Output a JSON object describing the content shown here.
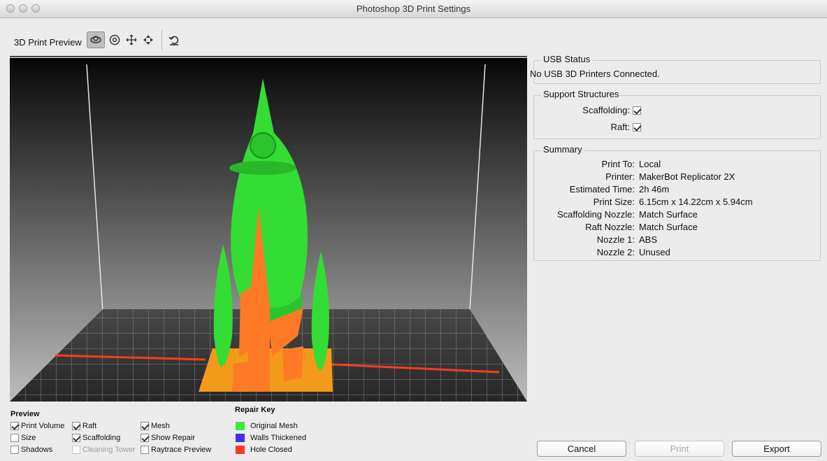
{
  "window": {
    "title": "Photoshop 3D Print Settings"
  },
  "toolbar": {
    "label": "3D Print Preview",
    "tools": [
      {
        "icon": "orbit-icon",
        "active": true
      },
      {
        "icon": "roll-icon",
        "active": false
      },
      {
        "icon": "pan-icon",
        "active": false
      },
      {
        "icon": "slide-icon",
        "active": false
      },
      {
        "icon": "reset-view-icon",
        "active": false
      }
    ]
  },
  "usb": {
    "title": "USB Status",
    "status": "No USB 3D Printers Connected."
  },
  "support": {
    "title": "Support Structures",
    "scaffolding_label": "Scaffolding:",
    "scaffolding_checked": true,
    "raft_label": "Raft:",
    "raft_checked": true
  },
  "summary": {
    "title": "Summary",
    "rows": [
      {
        "label": "Print To:",
        "value": "Local"
      },
      {
        "label": "Printer:",
        "value": "MakerBot Replicator 2X"
      },
      {
        "label": "Estimated Time:",
        "value": "2h 46m"
      },
      {
        "label": "Print Size:",
        "value": "6.15cm x 14.22cm x 5.94cm"
      },
      {
        "label": "Scaffolding Nozzle:",
        "value": "Match Surface"
      },
      {
        "label": "Raft Nozzle:",
        "value": "Match Surface"
      },
      {
        "label": "Nozzle 1:",
        "value": "ABS"
      },
      {
        "label": "Nozzle 2:",
        "value": "Unused"
      }
    ]
  },
  "preview": {
    "title": "Preview",
    "options": {
      "print_volume": {
        "label": "Print Volume",
        "checked": true
      },
      "size": {
        "label": "Size",
        "checked": false
      },
      "shadows": {
        "label": "Shadows",
        "checked": false
      },
      "raft": {
        "label": "Raft",
        "checked": true
      },
      "scaffolding": {
        "label": "Scaffolding",
        "checked": true
      },
      "cleaning_tower": {
        "label": "Cleaning Tower",
        "checked": false,
        "disabled": true
      },
      "mesh": {
        "label": "Mesh",
        "checked": true
      },
      "show_repair": {
        "label": "Show Repair",
        "checked": true
      },
      "raytrace_preview": {
        "label": "Raytrace Preview",
        "checked": false
      }
    }
  },
  "repair_key": {
    "title": "Repair Key",
    "items": [
      {
        "label": "Original Mesh",
        "color": "#3ee83e"
      },
      {
        "label": "Walls Thickened",
        "color": "#3b31f2"
      },
      {
        "label": "Hole Closed",
        "color": "#ff3b1e"
      }
    ]
  },
  "colors": {
    "mesh_green": "#33dd33",
    "scaffold_orange": "#ff7a26",
    "raft_orange": "#f39a1d",
    "repair_red": "#ff3b1e"
  },
  "buttons": {
    "cancel": "Cancel",
    "print": "Print",
    "export": "Export"
  }
}
